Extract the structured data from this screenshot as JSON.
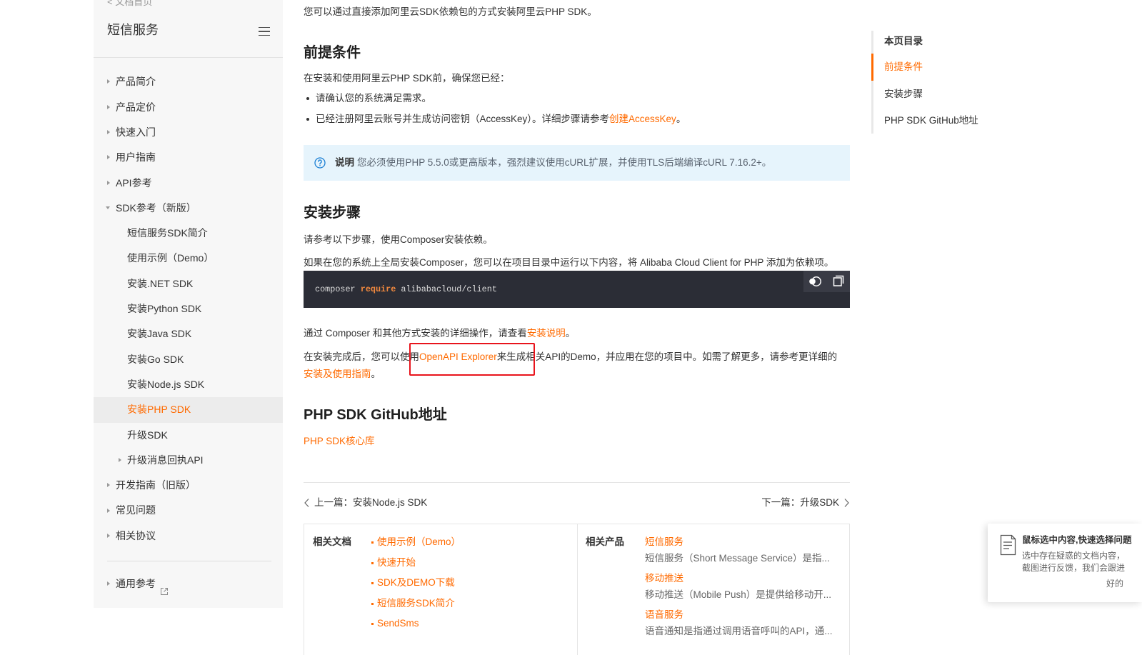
{
  "theme": {
    "accent": "#ff6a00",
    "sidebar_bg": "#f7f7f7",
    "note_bg": "#e6f4fc",
    "code_bg": "#2b2d36",
    "annotation": "#e8141c"
  },
  "sidebar": {
    "back_link": "< 文档首页",
    "title": "短信服务",
    "menu_icon": "hamburger-icon",
    "items": [
      {
        "label": "产品简介"
      },
      {
        "label": "产品定价"
      },
      {
        "label": "快速入门"
      },
      {
        "label": "用户指南"
      },
      {
        "label": "API参考"
      },
      {
        "label": "SDK参考（新版）",
        "expanded": true,
        "children": [
          {
            "label": "短信服务SDK简介"
          },
          {
            "label": "使用示例（Demo）"
          },
          {
            "label": "安装.NET SDK"
          },
          {
            "label": "安装Python SDK"
          },
          {
            "label": "安装Java SDK"
          },
          {
            "label": "安装Go SDK"
          },
          {
            "label": "安装Node.js SDK"
          },
          {
            "label": "安装PHP SDK",
            "active": true
          },
          {
            "label": "升级SDK"
          },
          {
            "label": "升级消息回执API",
            "has_children": true
          }
        ]
      },
      {
        "label": "开发指南（旧版）"
      },
      {
        "label": "常见问题"
      },
      {
        "label": "相关协议"
      }
    ],
    "footer_item": {
      "label": "通用参考",
      "icon": "external-link-icon"
    }
  },
  "article": {
    "intro": "您可以通过直接添加阿里云SDK依赖包的方式安装阿里云PHP SDK。",
    "prereq": {
      "heading": "前提条件",
      "lead": "在安装和使用阿里云PHP SDK前，确保您已经：",
      "bullet1": "请确认您的系统满足需求。",
      "bullet2": {
        "before": "已经注册阿里云账号并生成访问密钥（AccessKey）。详细步骤请参考",
        "link": "创建AccessKey",
        "after": "。"
      },
      "note": {
        "icon": "question-circle-icon",
        "label": "说明",
        "text": "您必须使用PHP 5.5.0或更高版本，强烈建议使用cURL扩展，并使用TLS后端编译cURL 7.16.2+。"
      }
    },
    "install": {
      "heading": "安装步骤",
      "p1": "请参考以下步骤，使用Composer安装依赖。",
      "p2": "如果在您的系统上全局安装Composer，您可以在项目目录中运行以下内容，将 Alibaba Cloud Client for PHP 添加为依赖项。",
      "code": {
        "command": "composer",
        "keyword": "require",
        "argument": "alibabacloud/client",
        "toolbar_icons": [
          "theme-toggle-icon",
          "copy-icon"
        ]
      },
      "p3": {
        "before": "通过 Composer 和其他方式安装的详细操作，请查看",
        "link": "安装说明",
        "after": "。"
      },
      "p4": {
        "before": "在安装完成后，您可以使用",
        "link": "OpenAPI Explorer",
        "middle": "来生成相关API的Demo，并应用在您的项目中。如需了解更多，请参考更详细的",
        "link2": "安装及使用指南",
        "after": "。"
      }
    },
    "github": {
      "heading": "PHP SDK GitHub地址",
      "link": "PHP SDK核心库"
    }
  },
  "pager": {
    "prev": "上一篇：安装Node.js SDK",
    "next": "下一篇：升级SDK"
  },
  "related": {
    "docs_label": "相关文档",
    "docs": [
      "使用示例（Demo）",
      "快速开始",
      "SDK及DEMO下载",
      "短信服务SDK简介",
      "SendSms"
    ],
    "products_label": "相关产品",
    "products": [
      {
        "name": "短信服务",
        "desc": "短信服务（Short Message Service）是指..."
      },
      {
        "name": "移动推送",
        "desc": "移动推送（Mobile Push）是提供给移动开..."
      },
      {
        "name": "语音服务",
        "desc": "语音通知是指通过调用语音呼叫的API，通..."
      }
    ]
  },
  "toc": {
    "title": "本页目录",
    "items": [
      {
        "label": "前提条件",
        "active": true
      },
      {
        "label": "安装步骤"
      },
      {
        "label": "PHP SDK GitHub地址"
      }
    ]
  },
  "feedback": {
    "icon": "document-feedback-icon",
    "title": "鼠标选中内容,快速选择问题",
    "line1": "选中存在疑惑的文档内容，",
    "line2": "截图进行反馈，我们会跟进",
    "ok": "好的"
  }
}
